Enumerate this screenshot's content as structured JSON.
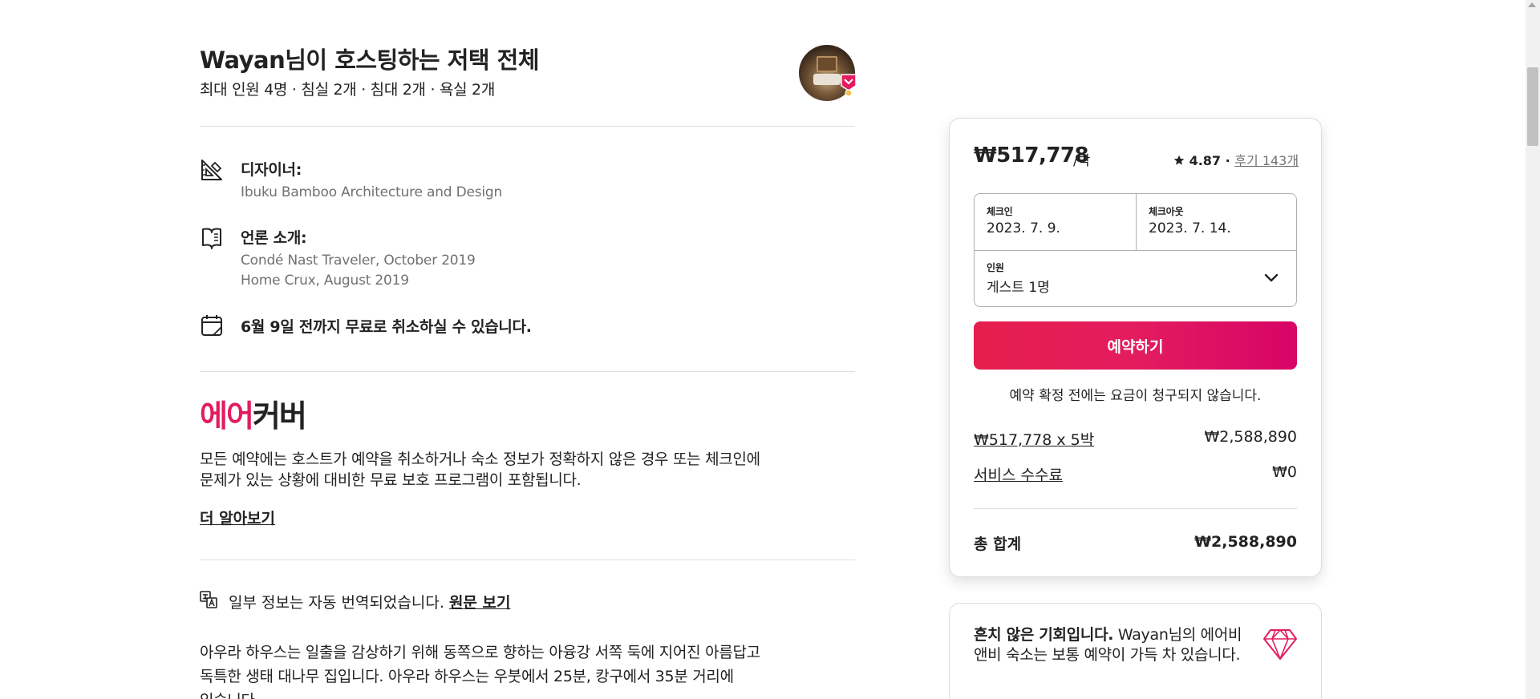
{
  "listing": {
    "title": "Wayan님이 호스팅하는 저택 전체",
    "subtitle": "최대 인원 4명 · 침실 2개 · 침대 2개 · 욕실 2개"
  },
  "host": {
    "avatar_icon": "host-avatar",
    "badge_icon": "superhost-badge-icon"
  },
  "features": [
    {
      "icon": "ruler-triangle-icon",
      "title": "디자이너:",
      "lines": [
        "Ibuku Bamboo Architecture and Design"
      ]
    },
    {
      "icon": "book-icon",
      "title": "언론 소개:",
      "lines": [
        "Condé Nast Traveler, October 2019",
        "Home Crux, August 2019"
      ]
    },
    {
      "icon": "calendar-icon",
      "title": "6월 9일 전까지 무료로 취소하실 수 있습니다.",
      "lines": []
    }
  ],
  "aircover": {
    "logo_red": "에어",
    "logo_dark": "커버",
    "description_line1": "모든 예약에는 호스트가 예약을 취소하거나 숙소 정보가 정확하지 않은 경우 또는 체크인에",
    "description_line2": "문제가 있는 상황에 대비한 무료 보호 프로그램이 포함됩니다.",
    "learn_more": "더 알아보기",
    "accent_color": "#e31c5f"
  },
  "translation": {
    "text": "일부 정보는 자동 번역되었습니다.",
    "link": "원문 보기"
  },
  "description": {
    "line1": "아우라 하우스는 일출을 감상하기 위해 동쪽으로 향하는 아융강 서쪽 둑에 지어진 아름답고",
    "line2": "독특한 생태 대나무 집입니다. 아우라 하우스는 우붓에서 25분, 캉구에서 35분 거리에",
    "line3": "있습니다."
  },
  "booking": {
    "price": "₩517,778",
    "per_night": "/박",
    "rating": "4.87",
    "separator": "·",
    "reviews": "후기 143개",
    "checkin_label": "체크인",
    "checkin_value": "2023. 7. 9.",
    "checkout_label": "체크아웃",
    "checkout_value": "2023. 7. 14.",
    "guests_label": "인원",
    "guests_value": "게스트 1명",
    "reserve_button": "예약하기",
    "note": "예약 확정 전에는 요금이 청구되지 않습니다.",
    "nights_line_label": "₩517,778 x 5박",
    "nights_line_value": "₩2,588,890",
    "service_fee_label": "서비스 수수료",
    "service_fee_value": "₩0",
    "total_label": "총 합계",
    "total_value": "₩2,588,890",
    "button_color": "#e31c5f"
  },
  "rare_find": {
    "bold": "흔치 않은 기회입니다.",
    "text": "Wayan님의 에어비앤비 숙소는 보통 예약이 가득 차 있습니다.",
    "icon": "diamond-icon"
  }
}
